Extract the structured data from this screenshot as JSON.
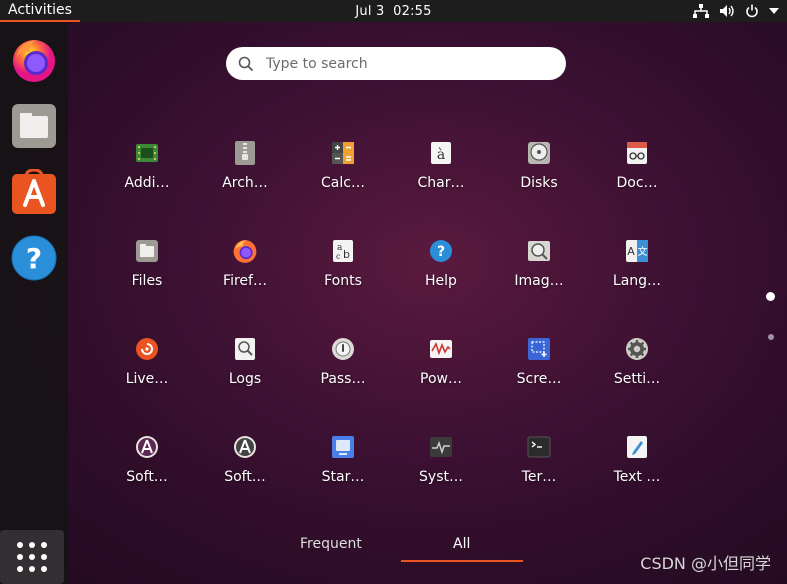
{
  "topbar": {
    "activities": "Activities",
    "date": "Jul 3",
    "time": "02:55"
  },
  "dock": {
    "items": [
      "firefox",
      "files",
      "software",
      "help"
    ],
    "show_apps": "show-apps"
  },
  "search": {
    "placeholder": "Type to search"
  },
  "apps": [
    {
      "label": "Addi…"
    },
    {
      "label": "Arch…"
    },
    {
      "label": "Calc…"
    },
    {
      "label": "Char…"
    },
    {
      "label": "Disks"
    },
    {
      "label": "Doc…"
    },
    {
      "label": "Files"
    },
    {
      "label": "Firef…"
    },
    {
      "label": "Fonts"
    },
    {
      "label": "Help"
    },
    {
      "label": "Imag…"
    },
    {
      "label": "Lang…"
    },
    {
      "label": "Live…"
    },
    {
      "label": "Logs"
    },
    {
      "label": "Pass…"
    },
    {
      "label": "Pow…"
    },
    {
      "label": "Scre…"
    },
    {
      "label": "Setti…"
    },
    {
      "label": "Soft…"
    },
    {
      "label": "Soft…"
    },
    {
      "label": "Star…"
    },
    {
      "label": "Syst…"
    },
    {
      "label": "Ter…"
    },
    {
      "label": "Text …"
    }
  ],
  "tabs": {
    "frequent": "Frequent",
    "all": "All"
  },
  "pager": {
    "current": 1,
    "total": 2
  },
  "watermark": "CSDN @小但同学",
  "colors": {
    "accent": "#e95420",
    "topbar": "#1d1d1d"
  }
}
